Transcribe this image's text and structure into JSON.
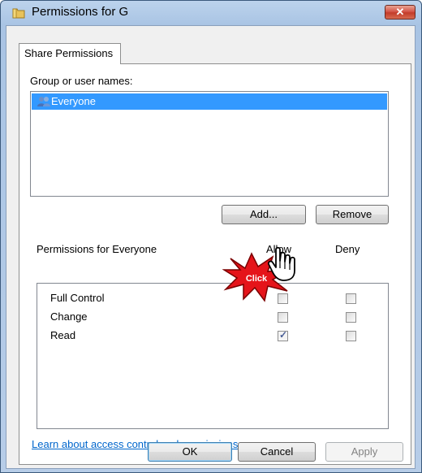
{
  "window": {
    "title": "Permissions for G",
    "close_label": "✕"
  },
  "tabs": [
    {
      "label": "Share Permissions"
    }
  ],
  "group_section": {
    "label": "Group or user names:",
    "items": [
      {
        "label": "Everyone",
        "selected": true,
        "icon": "users-icon"
      }
    ]
  },
  "buttons": {
    "add": "Add...",
    "remove": "Remove",
    "ok": "OK",
    "cancel": "Cancel",
    "apply": "Apply"
  },
  "permissions": {
    "header": "Permissions for Everyone",
    "allow_col": "Allow",
    "deny_col": "Deny",
    "rows": [
      {
        "name": "Full Control",
        "allow": false,
        "deny": false
      },
      {
        "name": "Change",
        "allow": false,
        "deny": false
      },
      {
        "name": "Read",
        "allow": true,
        "deny": false
      }
    ]
  },
  "link": "Learn about access control and permissions",
  "overlay": {
    "click_label": "Click"
  },
  "colors": {
    "selection": "#3399ff",
    "link": "#0066cc",
    "burst": "#e5141a"
  }
}
